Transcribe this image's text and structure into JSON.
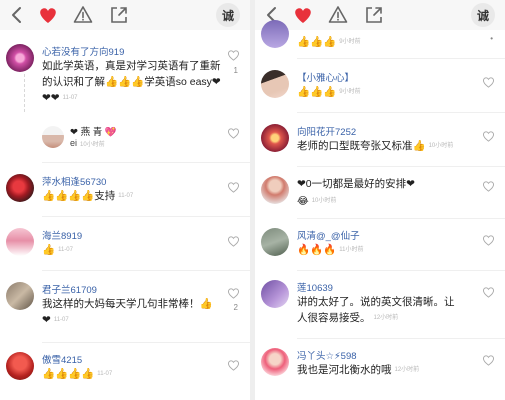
{
  "toolbar": {
    "icons": [
      "chevron-left-icon",
      "heart-icon",
      "alert-icon",
      "share-icon"
    ],
    "avatar_char": "诚",
    "accent": "#e8313b"
  },
  "left_comments": [
    {
      "name": "心若没有了方向919",
      "body": "如此学英语，真是对学习英语有了重新的认识和了解👍👍👍学英语so easy❤❤❤",
      "time": "11-07",
      "likes": "1"
    },
    {
      "reply_name": "❤ 燕 青 💖",
      "reply_body": "ei",
      "reply_time": "10小时前"
    },
    {
      "name": "萍水相逢56730",
      "body": "👍👍👍👍支持",
      "time": "11-07",
      "likes": ""
    },
    {
      "name": "海兰8919",
      "body": "👍",
      "time": "11-07",
      "likes": ""
    },
    {
      "name": "君子兰61709",
      "body": "我这样的大妈每天学几句非常棒！👍 ❤",
      "time": "11-07",
      "likes": "2"
    },
    {
      "name": "傲雪4215",
      "body": "👍👍👍👍",
      "time": "11-07",
      "likes": ""
    }
  ],
  "right_comments": [
    {
      "name": "",
      "body": "👍👍👍",
      "time": "9小时前",
      "likes": ""
    },
    {
      "name": "【小雅心心】",
      "body": "👍👍👍",
      "time": "9小时前",
      "likes": ""
    },
    {
      "name": "向阳花开7252",
      "body": "老师的口型既夸张又标准👍",
      "time": "10小时前",
      "likes": ""
    },
    {
      "name": "",
      "body": "❤0一切都是最好的安排❤",
      "time": "10小时前",
      "likes": "",
      "extra": "😂"
    },
    {
      "name": "风清@_@仙子",
      "body": "🔥🔥🔥",
      "time": "11小时前",
      "likes": ""
    },
    {
      "name": "莲10639",
      "body": "讲的太好了。说的英文很清晰。让人很容易接受。",
      "time": "12小时前",
      "likes": ""
    },
    {
      "name": "冯丫头☆⚡598",
      "body": "我也是河北衡水的哦",
      "time": "12小时前",
      "likes": ""
    }
  ]
}
